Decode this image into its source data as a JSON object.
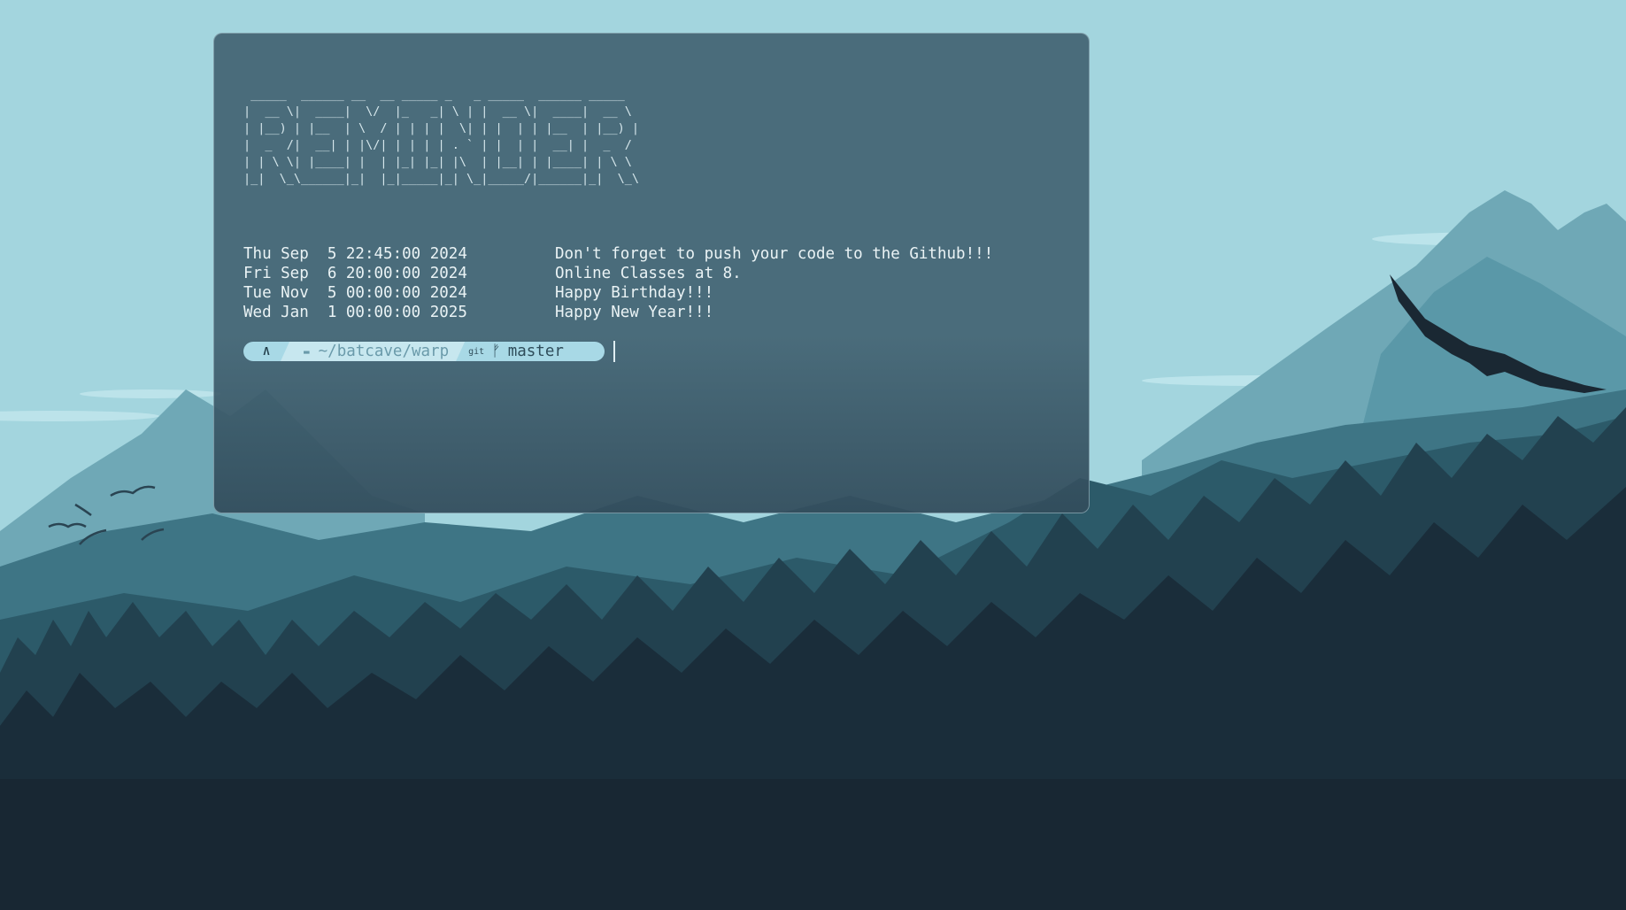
{
  "ascii_banner": [
    " _____  ______ __  __ _____ _   _ _____  ______ _____  ",
    "|  __ \\|  ____|  \\/  |_   _| \\ | |  __ \\|  ____|  __ \\ ",
    "| |__) | |__  | \\  / | | | |  \\| | |  | | |__  | |__) |",
    "|  _  /|  __| | |\\/| | | | | . ` | |  | |  __| |  _  / ",
    "| | \\ \\| |____| |  | |_| |_| |\\  | |__| | |____| | \\ \\ ",
    "|_|  \\_\\______|_|  |_|_____|_| \\_|_____/|______|_|  \\_\\"
  ],
  "reminders": [
    {
      "date": "Thu Sep  5 22:45:00 2024",
      "message": "Don't forget to push your code to the Github!!!"
    },
    {
      "date": "Fri Sep  6 20:00:00 2024",
      "message": "Online Classes at 8."
    },
    {
      "date": "Tue Nov  5 00:00:00 2024",
      "message": "Happy Birthday!!!"
    },
    {
      "date": "Wed Jan  1 00:00:00 2025",
      "message": "Happy New Year!!!"
    }
  ],
  "prompt": {
    "home_icon": "arch-icon",
    "home_glyph": "Λ",
    "folder_icon": "folder-icon",
    "folder_glyph": "▬",
    "path": "~/batcave/warp",
    "git_icon": "git-icon",
    "git_glyph": "git",
    "branch_icon": "branch-icon",
    "branch_glyph": "ᚠ",
    "branch": "master"
  },
  "colors": {
    "sky": "#a3d5de",
    "terminal_bg": "#406070",
    "text": "#eaf3f5",
    "prompt_bg": "#a8d9e6",
    "prompt_path_bg": "#c7e7ef",
    "forest_dark": "#182733"
  }
}
